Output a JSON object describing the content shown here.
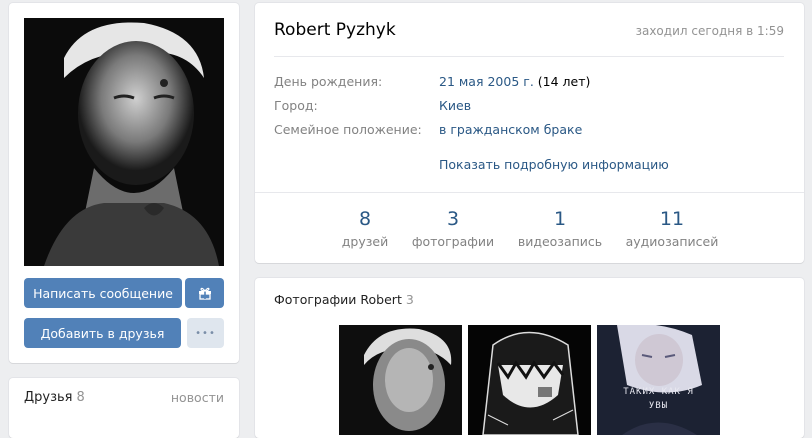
{
  "profile": {
    "name": "Robert Pyzhyk",
    "last_seen": "заходил сегодня в 1:59"
  },
  "info": {
    "birthday_label": "День рождения:",
    "birthday_date": "21 мая 2005 г.",
    "birthday_age": "(14 лет)",
    "city_label": "Город:",
    "city_value": "Киев",
    "family_label": "Семейное положение:",
    "family_value": "в гражданском браке",
    "more_link": "Показать подробную информацию"
  },
  "counters": [
    {
      "value": "8",
      "label": "друзей"
    },
    {
      "value": "3",
      "label": "фотографии"
    },
    {
      "value": "1",
      "label": "видеозапись"
    },
    {
      "value": "11",
      "label": "аудиозаписей"
    }
  ],
  "actions": {
    "message_label": "Написать сообщение",
    "add_friend_label": "Добавить в друзья",
    "more_label": "•••"
  },
  "friends": {
    "title": "Друзья",
    "count": "8",
    "news_link": "новости"
  },
  "photos": {
    "title": "Фотографии Robert",
    "count": "3",
    "photo3_caption_1": "ТАКИХ КАК Я",
    "photo3_caption_2": "УВЫ"
  },
  "colors": {
    "page_bg": "#edeef0",
    "link": "#2a5885",
    "button_primary": "#5181b8",
    "button_secondary": "#dfe6ee"
  }
}
